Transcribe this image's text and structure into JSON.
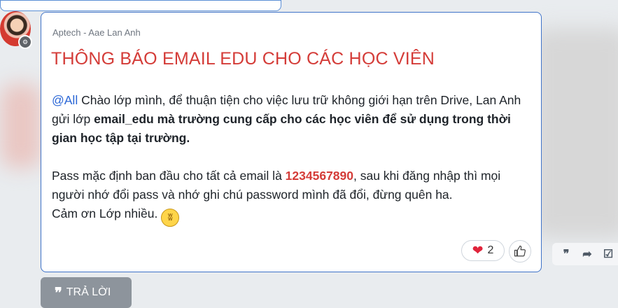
{
  "message": {
    "sender": "Aptech - Aae Lan Anh",
    "title": "THÔNG BÁO EMAIL EDU CHO CÁC HỌC VIÊN",
    "paragraph1": {
      "mention": "@All",
      "text1": " Chào lớp mình, để thuận tiện cho việc lưu trữ không giới hạn trên Drive, Lan Anh gửi lớp ",
      "bold": "email_edu mà trường cung cấp cho các học viên để sử dụng trong thời gian học tập tại trường."
    },
    "paragraph2": {
      "text1": "Pass mặc định ban đầu cho tất cả email là ",
      "password": "1234567890",
      "text2": ", sau khi đăng nhập thì mọi người nhớ đổi pass và nhớ ghi chú password mình đã đổi, đừng quên ha."
    },
    "paragraph3": "Cảm ơn Lớp nhiều.",
    "emoji_icon": "grinning-face-icon"
  },
  "reactions": {
    "heart_count": "2",
    "heart_icon": "heart-icon",
    "like_icon": "thumbs-up-icon"
  },
  "actions": {
    "quote_icon": "quote-icon",
    "forward_icon": "forward-icon",
    "select_icon": "checkbox-icon"
  },
  "reply_button": {
    "label": "TRẢ LỜI",
    "icon": "quote-icon"
  },
  "colors": {
    "title": "#d43c38",
    "mention": "#2a66d6",
    "card_border": "#3f73c8"
  }
}
